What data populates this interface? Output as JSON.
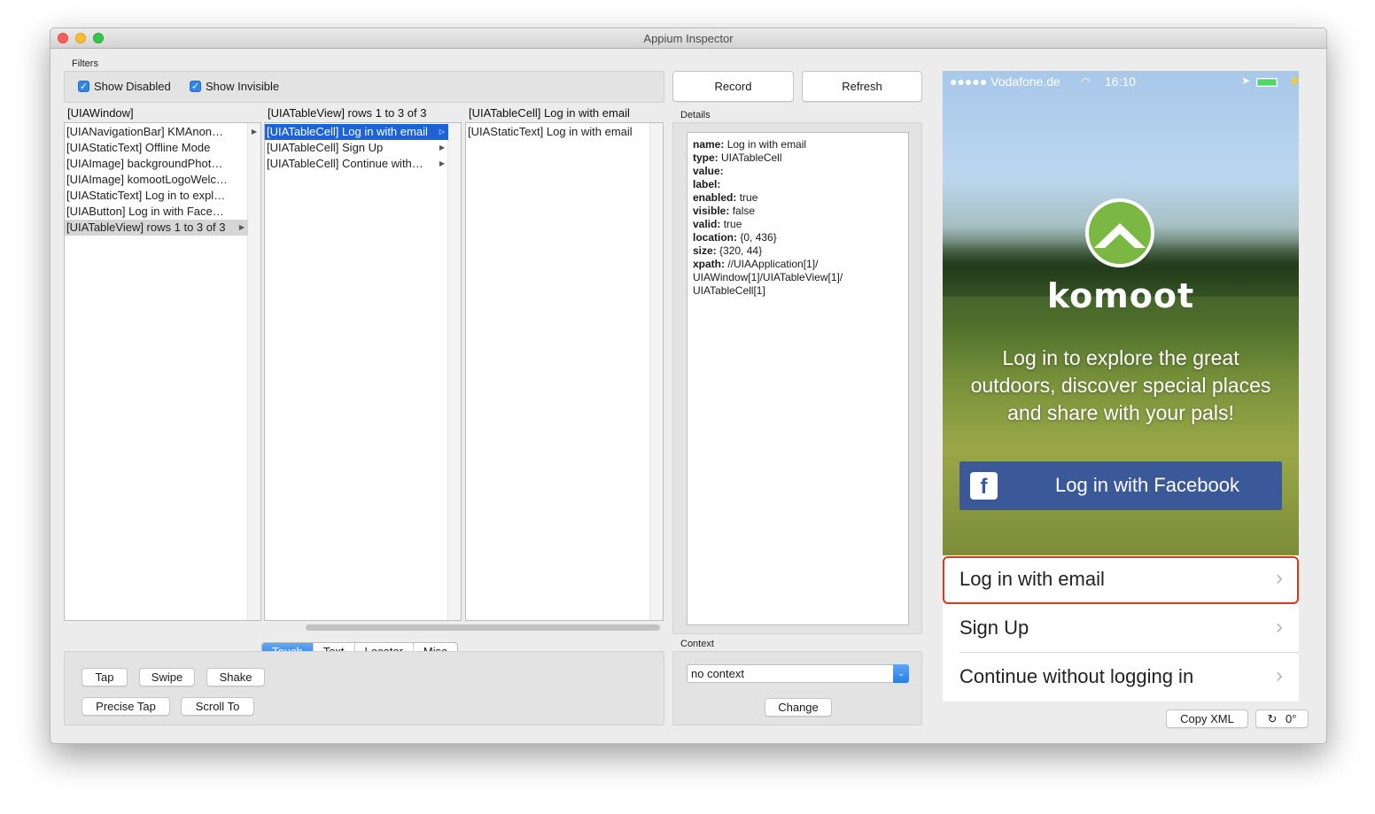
{
  "window": {
    "title": "Appium Inspector"
  },
  "filters": {
    "label": "Filters",
    "show_disabled": "Show Disabled",
    "show_invisible": "Show Invisible"
  },
  "columns": [
    {
      "header": "[UIAWindow]",
      "rows": [
        "[UIANavigationBar] KMAnon…",
        "[UIAStaticText] Offline Mode",
        "[UIAImage] backgroundPhot…",
        "[UIAImage] komootLogoWelc…",
        "[UIAStaticText] Log in to expl…",
        "[UIAButton] Log in with Face…",
        "[UIATableView] rows 1 to 3 of 3"
      ]
    },
    {
      "header": "[UIATableView] rows 1 to 3 of 3",
      "rows": [
        "[UIATableCell] Log in with email",
        "[UIATableCell] Sign Up",
        "[UIATableCell] Continue with…"
      ]
    },
    {
      "header": "[UIATableCell] Log in with email",
      "rows": [
        "[UIAStaticText] Log in with email"
      ]
    }
  ],
  "toolbar": {
    "record": "Record",
    "refresh": "Refresh"
  },
  "details": {
    "label": "Details",
    "fields": {
      "name_k": "name:",
      "name_v": "Log in with email",
      "type_k": "type:",
      "type_v": "UIATableCell",
      "value_k": "value:",
      "label_k": "label:",
      "enabled_k": "enabled:",
      "enabled_v": "true",
      "visible_k": "visible:",
      "visible_v": "false",
      "valid_k": "valid:",
      "valid_v": "true",
      "location_k": "location:",
      "location_v": "{0, 436}",
      "size_k": "size:",
      "size_v": "{320, 44}",
      "xpath_k": "xpath:",
      "xpath_v": "//UIAApplication[1]/ UIAWindow[1]/UIATableView[1]/ UIATableCell[1]"
    }
  },
  "tabs": [
    "Touch",
    "Text",
    "Locator",
    "Misc"
  ],
  "actions": {
    "tap": "Tap",
    "swipe": "Swipe",
    "shake": "Shake",
    "precise_tap": "Precise Tap",
    "scroll_to": "Scroll To"
  },
  "context": {
    "label": "Context",
    "selected": "no context",
    "change": "Change"
  },
  "phone": {
    "carrier": "●●●●● Vodafone.de",
    "time": "16:10",
    "wordmark": "komoot",
    "tagline": "Log in to explore the great outdoors, discover special places and share with your pals!",
    "facebook_button": "Log in with Facebook",
    "cells": [
      "Log in with email",
      "Sign Up",
      "Continue without logging in"
    ]
  },
  "bottom": {
    "copy_xml": "Copy XML",
    "rotation": "0°"
  },
  "colors": {
    "selection": "#1b63d6",
    "accent": "#2f80ea",
    "facebook": "#3b5998",
    "highlight": "#e0341a",
    "komoot_green": "#7ab843"
  }
}
